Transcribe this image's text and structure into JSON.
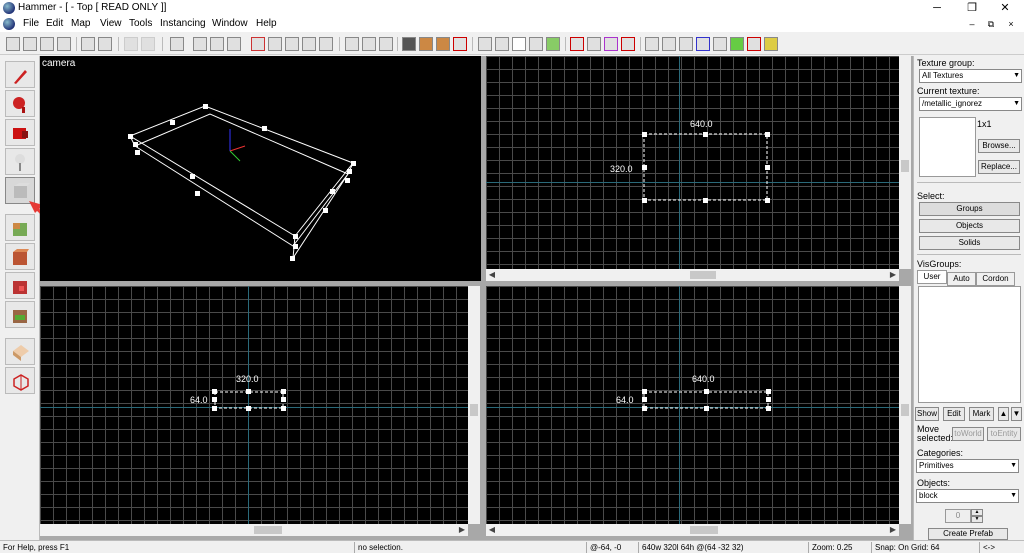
{
  "window": {
    "title": "Hammer - [ - Top [ READ ONLY ]]",
    "minimize": "─",
    "maximize": "❐",
    "close": "✕"
  },
  "menu": {
    "items": [
      "File",
      "Edit",
      "Map",
      "View",
      "Tools",
      "Instancing",
      "Window",
      "Help"
    ],
    "mdi_min": "–",
    "mdi_restore": "⧉",
    "mdi_close": "×"
  },
  "viewports": {
    "camera": {
      "label": "camera"
    },
    "top": {
      "width_label": "640.0",
      "height_label": "320.0"
    },
    "front": {
      "width_label": "320.0",
      "height_label": "64.0"
    },
    "side": {
      "width_label": "640.0",
      "height_label": "64.0"
    }
  },
  "right_panel": {
    "texture_group_label": "Texture group:",
    "texture_group_value": "All Textures",
    "current_texture_label": "Current texture:",
    "current_texture_value": "/metallic_ignorez",
    "texture_size": "1x1",
    "browse_btn": "Browse...",
    "replace_btn": "Replace...",
    "select_label": "Select:",
    "groups_btn": "Groups",
    "objects_btn": "Objects",
    "solids_btn": "Solids",
    "visgroups_label": "VisGroups:",
    "tabs": [
      "User",
      "Auto",
      "Cordon"
    ],
    "show_btn": "Show",
    "edit_btn": "Edit",
    "mark_btn": "Mark",
    "move_selected_label": "Move selected:",
    "toworld_btn": "toWorld",
    "toentity_btn": "toEntity",
    "categories_label": "Categories:",
    "categories_value": "Primitives",
    "objects_label": "Objects:",
    "objects_value": "block",
    "faces_value": "0",
    "create_prefab_btn": "Create Prefab"
  },
  "status": {
    "help": "For Help, press F1",
    "selection": "no selection.",
    "coords": "@-64, -0",
    "size": "640w 320l 64h @(64 -32 32)",
    "zoom": "Zoom: 0.25",
    "snap": "Snap: On Grid: 64",
    "nav": "<->"
  },
  "colors": {
    "annotation_arrow": "#e53935",
    "grid_line": "#4a4a4a",
    "grid_axis": "#2a6a7a"
  }
}
